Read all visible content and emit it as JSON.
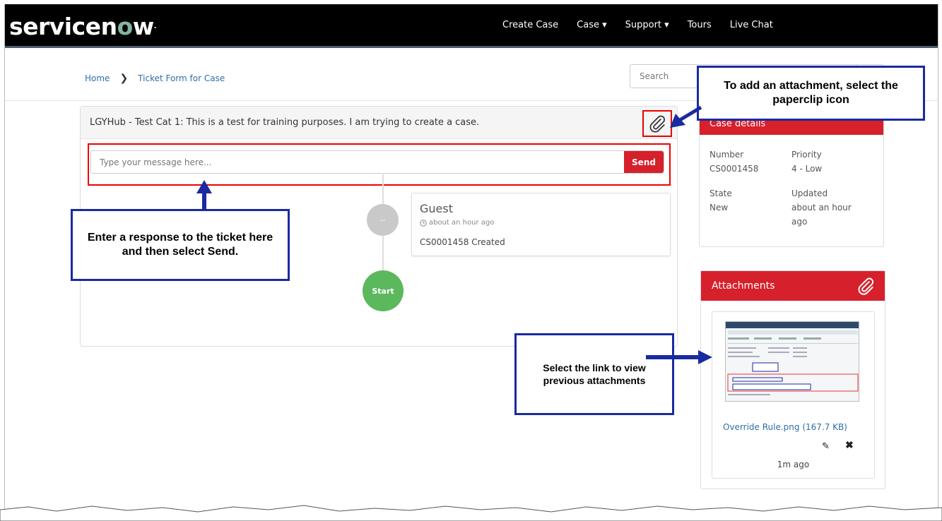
{
  "header": {
    "logo": "servicenow",
    "nav": [
      "Create Case",
      "Case ▾",
      "Support ▾",
      "Tours",
      "Live Chat"
    ]
  },
  "breadcrumb": {
    "home": "Home",
    "current": "Ticket Form for Case"
  },
  "search": {
    "placeholder": "Search"
  },
  "ticket": {
    "title": "LGYHub - Test Cat 1: This is a test for training purposes. I am trying to create a case.",
    "message_placeholder": "Type your message here...",
    "send_label": "Send",
    "entry": {
      "author": "Guest",
      "time": "about an hour ago",
      "text": "CS0001458 Created",
      "avatar": "--"
    },
    "start_label": "Start"
  },
  "details": {
    "heading": "Case details",
    "number_label": "Number",
    "number": "CS0001458",
    "priority_label": "Priority",
    "priority": "4 - Low",
    "state_label": "State",
    "state": "New",
    "updated_label": "Updated",
    "updated": "about an hour ago"
  },
  "attachments": {
    "heading": "Attachments",
    "file": "Override Rule.png (167.7 KB)",
    "age": "1m ago"
  },
  "callouts": {
    "attach": "To add an attachment, select the paperclip icon",
    "response": "Enter a response to the ticket here and then select Send.",
    "link": "Select the link to view previous attachments"
  },
  "colors": {
    "brand_red": "#d6202c",
    "callout_blue": "#1a2aa0",
    "start_green": "#5cb85c",
    "link_blue": "#2f6fa8"
  }
}
